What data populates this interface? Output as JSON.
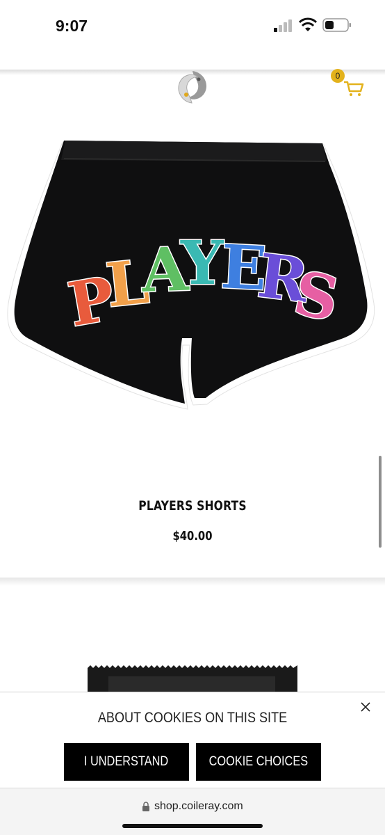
{
  "status_bar": {
    "time": "9:07"
  },
  "header": {
    "logo_icon": "koi-fish-logo-icon",
    "cart_count": "0",
    "cart_icon": "shopping-cart-icon",
    "accent_color": "#e3b21c"
  },
  "product": {
    "image_text": "PLAYERS",
    "title": "PLAYERS SHORTS",
    "price": "$40.00"
  },
  "cookie_banner": {
    "title": "ABOUT COOKIES ON THIS SITE",
    "understand_label": "I UNDERSTAND",
    "choices_label": "COOKIE CHOICES",
    "close_icon": "close-icon"
  },
  "browser": {
    "url": "shop.coileray.com",
    "lock_icon": "lock-icon"
  }
}
